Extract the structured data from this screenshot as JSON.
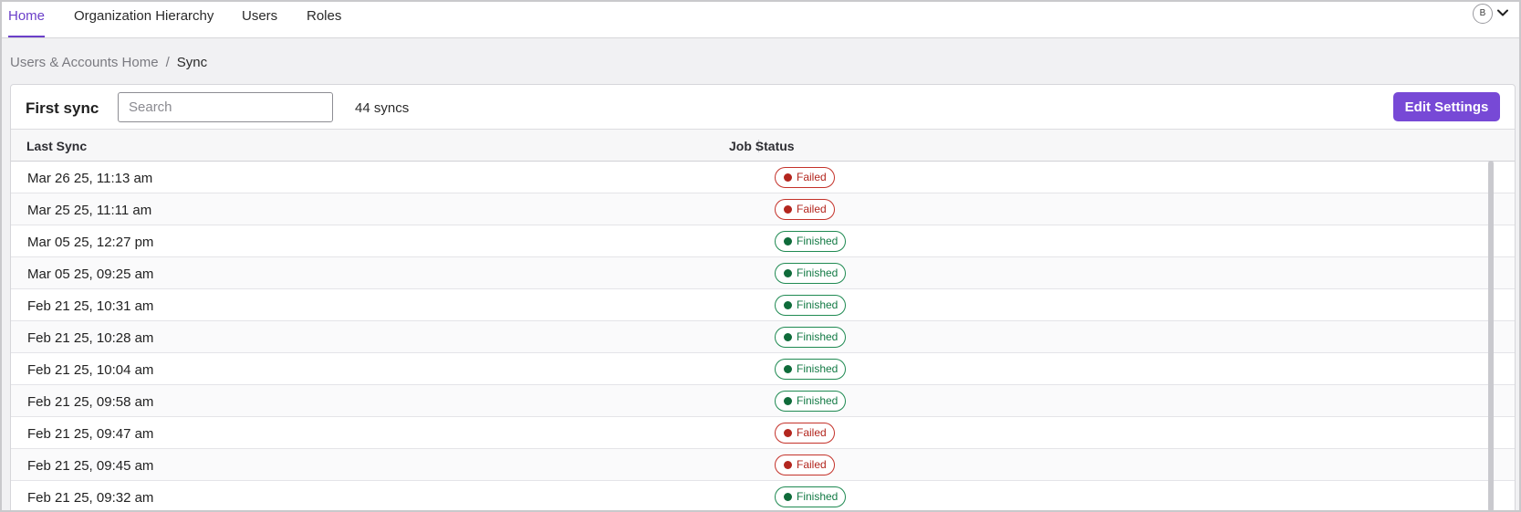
{
  "nav": {
    "tabs": [
      {
        "label": "Home",
        "active": true
      },
      {
        "label": "Organization Hierarchy",
        "active": false
      },
      {
        "label": "Users",
        "active": false
      },
      {
        "label": "Roles",
        "active": false
      }
    ],
    "avatar_initial": "B",
    "avatar_menu_icon": "chevron-down-icon"
  },
  "breadcrumb": {
    "parent": "Users & Accounts Home",
    "separator": "/",
    "current": "Sync"
  },
  "card": {
    "title": "First sync",
    "search_placeholder": "Search",
    "search_value": "",
    "count_label": "44 syncs",
    "edit_button": "Edit Settings"
  },
  "table": {
    "columns": [
      "Last Sync",
      "Job Status"
    ],
    "rows": [
      {
        "last_sync": "Mar 26 25, 11:13 am",
        "status": "Failed"
      },
      {
        "last_sync": "Mar 25 25, 11:11 am",
        "status": "Failed"
      },
      {
        "last_sync": "Mar 05 25, 12:27 pm",
        "status": "Finished"
      },
      {
        "last_sync": "Mar 05 25, 09:25 am",
        "status": "Finished"
      },
      {
        "last_sync": "Feb 21 25, 10:31 am",
        "status": "Finished"
      },
      {
        "last_sync": "Feb 21 25, 10:28 am",
        "status": "Finished"
      },
      {
        "last_sync": "Feb 21 25, 10:04 am",
        "status": "Finished"
      },
      {
        "last_sync": "Feb 21 25, 09:58 am",
        "status": "Finished"
      },
      {
        "last_sync": "Feb 21 25, 09:47 am",
        "status": "Failed"
      },
      {
        "last_sync": "Feb 21 25, 09:45 am",
        "status": "Failed"
      },
      {
        "last_sync": "Feb 21 25, 09:32 am",
        "status": "Finished"
      }
    ]
  },
  "colors": {
    "accent": "#6b3fc9",
    "button": "#7749d6",
    "failed": "#b3261e",
    "finished": "#137a45"
  }
}
